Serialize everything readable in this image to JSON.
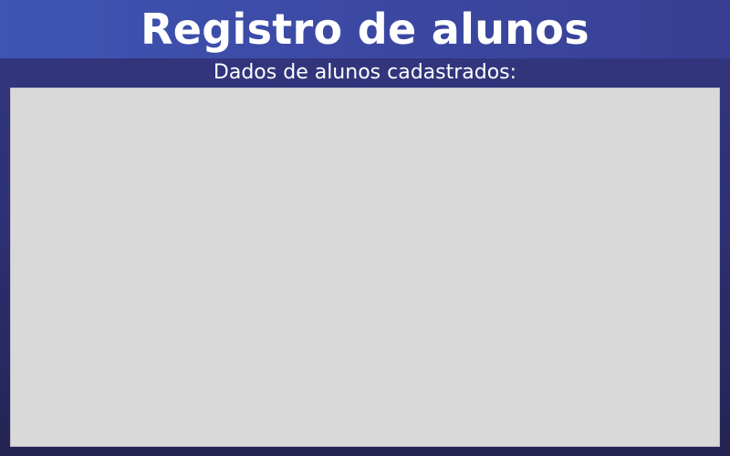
{
  "header": {
    "title": "Registro de alunos"
  },
  "main": {
    "subtitle": "Dados de alunos cadastrados:",
    "records": []
  },
  "colors": {
    "title_bar": "#3c4ba6",
    "background": "#2e3177",
    "panel": "#d9d9d9",
    "text": "#ffffff"
  }
}
